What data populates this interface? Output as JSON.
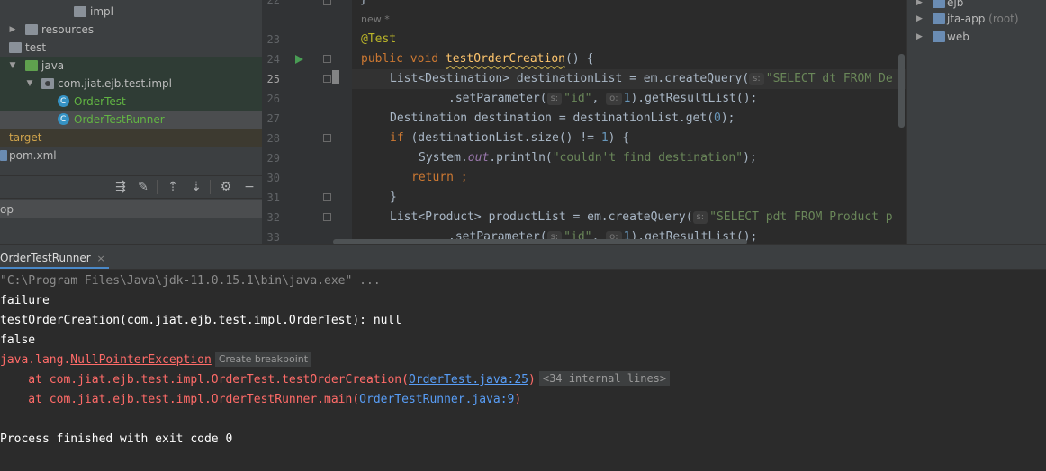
{
  "project_tree": {
    "items": [
      {
        "label": "impl"
      },
      {
        "label": "resources"
      },
      {
        "label": "test"
      },
      {
        "label": "java"
      },
      {
        "label": "com.jiat.ejb.test.impl"
      },
      {
        "label": "OrderTest"
      },
      {
        "label": "OrderTestRunner"
      },
      {
        "label": "target"
      },
      {
        "label": "pom.xml"
      }
    ],
    "panel2_label": "op"
  },
  "editor": {
    "line_numbers": [
      "22",
      "23",
      "24",
      "25",
      "26",
      "27",
      "28",
      "29",
      "30",
      "31",
      "32",
      "33"
    ],
    "new_hint": "new *",
    "hints": {
      "s": "s:",
      "o": "o:"
    },
    "code": {
      "l23_ann": "@Test",
      "l24_kw1": "public",
      "l24_kw2": "void",
      "l24_fn": "testOrderCreation",
      "l24_rest": "() {",
      "l25_a": "List<Destination> destinationList = em.createQuery(",
      "l25_str": "\"SELECT dt FROM De",
      "l26_a": ".setParameter(",
      "l26_str": "\"id\"",
      "l26_b": ", ",
      "l26_num": "1",
      "l26_c": ").getResultList();",
      "l27_a": "Destination destination = destinationList.get(",
      "l27_num": "0",
      "l27_c": ");",
      "l28_kw": "if",
      "l28_a": " (destinationList.size() != ",
      "l28_num": "1",
      "l28_c": ") {",
      "l29_a": "System.",
      "l29_fld": "out",
      "l29_b": ".println(",
      "l29_str": "\"couldn't find destination\"",
      "l29_c": ");",
      "l30_kw": "return",
      "l30_c": " ;",
      "l31_a": "}",
      "l32_a": "List<Product> productList = em.createQuery(",
      "l32_str": "\"SELECT pdt FROM Product p",
      "l33_a": ".setParameter(",
      "l33_str": "\"id\"",
      "l33_b": ", ",
      "l33_num": "1",
      "l33_c": ").getResultList();"
    }
  },
  "right_panel": {
    "items": [
      {
        "label": "ejb",
        "sub": ""
      },
      {
        "label": "jta-app",
        "sub": "(root)"
      },
      {
        "label": "web",
        "sub": ""
      }
    ]
  },
  "run": {
    "tab_label": "OrderTestRunner",
    "close_glyph": "×",
    "console": {
      "cmd": "\"C:\\Program Files\\Java\\jdk-11.0.15.1\\bin\\java.exe\" ...",
      "line1": "failure",
      "line2": "testOrderCreation(com.jiat.ejb.test.impl.OrderTest): null",
      "line3": "false",
      "exc_prefix": "java.lang.",
      "exc_name": "NullPointerException",
      "create_breakpoint": "Create breakpoint",
      "st1_a": "    at com.jiat.ejb.test.impl.OrderTest.testOrderCreation(",
      "st1_link": "OrderTest.java:25",
      "st1_b": ")",
      "internal_lines": "<34 internal lines>",
      "st2_a": "    at com.jiat.ejb.test.impl.OrderTestRunner.main(",
      "st2_link": "OrderTestRunner.java:9",
      "st2_b": ")",
      "exit": "Process finished with exit code 0"
    }
  }
}
